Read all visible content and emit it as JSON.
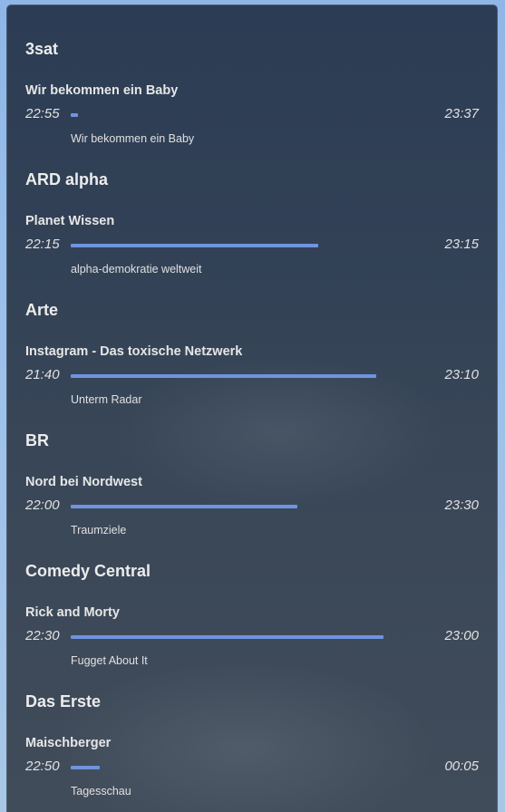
{
  "colors": {
    "accent": "#6f94e0",
    "card_background": "#334256",
    "text": "#ececec"
  },
  "channels": [
    {
      "name": "3sat",
      "show": "Wir bekommen ein Baby",
      "start": "22:55",
      "end": "23:37",
      "progress": 0.02,
      "next": "Wir bekommen ein Baby"
    },
    {
      "name": "ARD alpha",
      "show": "Planet Wissen",
      "start": "22:15",
      "end": "23:15",
      "progress": 0.7,
      "next": "alpha-demokratie weltweit"
    },
    {
      "name": "Arte",
      "show": "Instagram - Das toxische Netzwerk",
      "start": "21:40",
      "end": "23:10",
      "progress": 0.864,
      "next": "Unterm Radar"
    },
    {
      "name": "BR",
      "show": "Nord bei Nordwest",
      "start": "22:00",
      "end": "23:30",
      "progress": 0.64,
      "next": "Traumziele"
    },
    {
      "name": "Comedy Central",
      "show": "Rick and Morty",
      "start": "22:30",
      "end": "23:00",
      "progress": 0.885,
      "next": "Fugget About It"
    },
    {
      "name": "Das Erste",
      "show": "Maischberger",
      "start": "22:50",
      "end": "00:05",
      "progress": 0.083,
      "next": "Tagesschau"
    }
  ]
}
